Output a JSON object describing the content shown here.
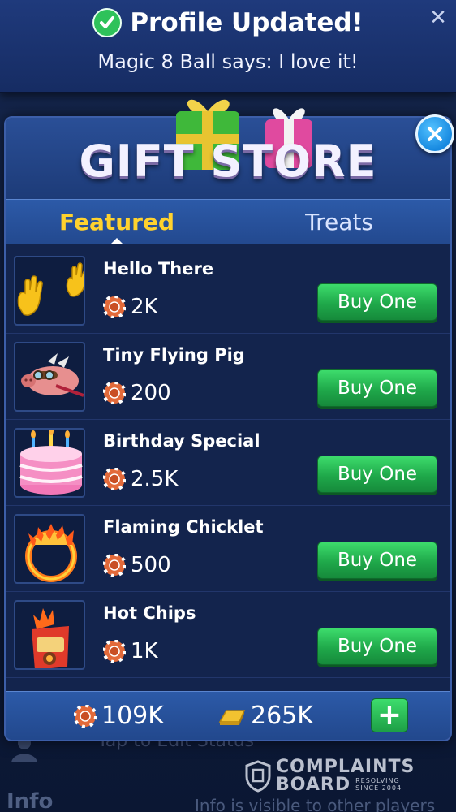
{
  "notification": {
    "title": "Profile Updated!",
    "subtitle": "Magic 8 Ball says: I love it!"
  },
  "background": {
    "status_text": "Tap to Edit Status",
    "info_label": "Info",
    "info_note": "Info is visible to other players"
  },
  "store": {
    "title": "GIFT STORE",
    "tabs": [
      {
        "label": "Featured",
        "active": true
      },
      {
        "label": "Treats",
        "active": false
      }
    ],
    "items": [
      {
        "name": "Hello There",
        "price": "2K",
        "button": "Buy One",
        "icon": "waving-hands-icon"
      },
      {
        "name": "Tiny Flying Pig",
        "price": "200",
        "button": "Buy One",
        "icon": "flying-pig-icon"
      },
      {
        "name": "Birthday Special",
        "price": "2.5K",
        "button": "Buy One",
        "icon": "birthday-cake-icon"
      },
      {
        "name": "Flaming Chicklet",
        "price": "500",
        "button": "Buy One",
        "icon": "flaming-ring-icon"
      },
      {
        "name": "Hot Chips",
        "price": "1K",
        "button": "Buy One",
        "icon": "hot-chips-icon"
      }
    ]
  },
  "balance": {
    "chips": "109K",
    "gold": "265K",
    "add_label": "+"
  },
  "watermark": {
    "line1": "COMPLAINTS",
    "line2": "BOARD",
    "tag1": "RESOLVING",
    "tag2": "SINCE 2004"
  },
  "colors": {
    "accent_tab": "#ffd22e",
    "buy_green": "#1fa84a",
    "close_blue": "#1789e0"
  }
}
